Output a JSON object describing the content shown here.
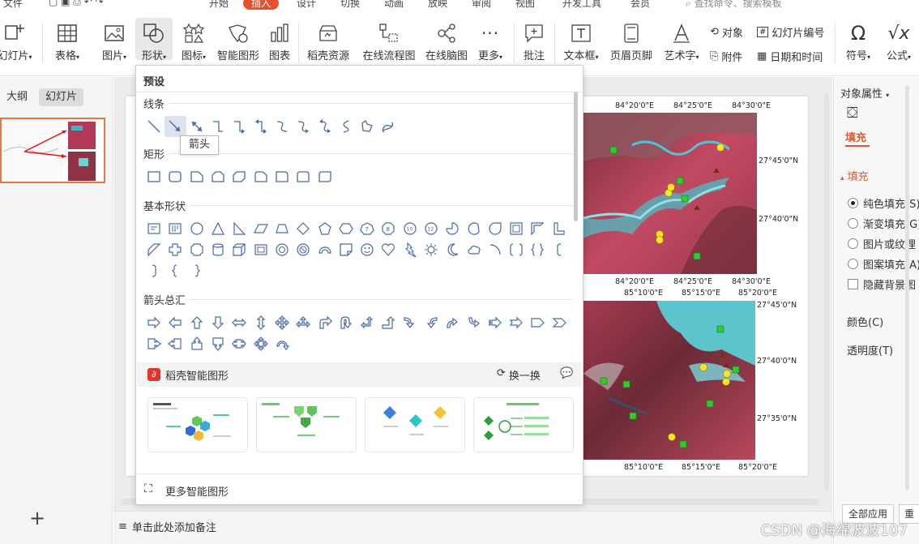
{
  "menubar": {
    "items": [
      "文件",
      "开始",
      "插入",
      "设计",
      "切换",
      "动画",
      "放映",
      "审阅",
      "视图",
      "开发工具",
      "会员",
      "查找命令、搜索模板"
    ],
    "active": "插入"
  },
  "ribbon": {
    "slide_num": "幻灯片",
    "table": "表格",
    "picture": "图片",
    "shape": "形状",
    "icon": "图标",
    "smartart": "智能图形",
    "chart": "图表",
    "docer": "稻壳资源",
    "flowchart": "在线流程图",
    "mindmap": "在线脑图",
    "more": "更多",
    "comment": "批注",
    "textbox": "文本框",
    "header_footer": "页眉页脚",
    "wordart": "艺术字",
    "object": "对象",
    "slide_number": "幻灯片编号",
    "attachment": "附件",
    "datetime": "日期和时间",
    "symbol": "符号",
    "formula": "公式"
  },
  "left_panel": {
    "tab_outline": "大纲",
    "tab_slides": "幻灯片",
    "add_label": "+"
  },
  "notes": {
    "placeholder": "单击此处添加备注"
  },
  "right_panel": {
    "title": "对象属性",
    "tab_fill": "填充",
    "section_fill": "填充",
    "options": [
      "纯色填充(S)",
      "渐变填充(G)",
      "图片或纹理",
      "图案填充(A)"
    ],
    "hide_bg": "隐藏背景图",
    "color": "颜色(C)",
    "transparency": "透明度(T)",
    "apply_all": "全部应用",
    "reset": "重"
  },
  "shape_panel": {
    "preset": "预设",
    "lines": "线条",
    "rectangles": "矩形",
    "basic": "基本形状",
    "arrows": "箭头总汇",
    "tooltip": "箭头",
    "smart_title": "稻壳智能图形",
    "swap": "换一换",
    "more_smart": "更多智能图形",
    "icons": {
      "lines": [
        "line-icon",
        "arrow-line-icon",
        "double-arrow-line-icon",
        "elbow-connector-icon",
        "elbow-arrow-icon",
        "elbow-double-arrow-icon",
        "curved-connector-icon",
        "curved-arrow-icon",
        "curved-double-arrow-icon",
        "curve-icon",
        "freeform-icon",
        "scribble-icon"
      ],
      "rects": [
        "rectangle-icon",
        "rounded-rectangle-icon",
        "snip-corner-rect-icon",
        "snip-same-side-rect-icon",
        "snip-diagonal-rect-icon",
        "snip-round-rect-icon",
        "round-corner-rect-icon",
        "round-same-side-rect-icon",
        "round-diagonal-rect-icon"
      ]
    }
  },
  "slide": {
    "top_x_labels": [
      "84°20'0\"E",
      "84°25'0\"E",
      "84°30'0\"E"
    ],
    "top_right_labels": [
      "27°45'0\"N",
      "27°40'0\"N"
    ],
    "mid_left_labels": [
      "84°20'0\"E",
      "84°25'0\"E",
      "84°30'0\"E"
    ],
    "mid_x_labels": [
      "85°10'0\"E",
      "85°15'0\"E",
      "85°20'0\"E"
    ],
    "bottom_right_labels": [
      "27°45'0\"N",
      "27°40'0\"N",
      "27°35'0\"N"
    ],
    "bottom_x_labels": [
      "85°10'0\"E",
      "85°15'0\"E",
      "85°20'0\"E"
    ]
  },
  "watermark": "CSDN @海绵波波107"
}
